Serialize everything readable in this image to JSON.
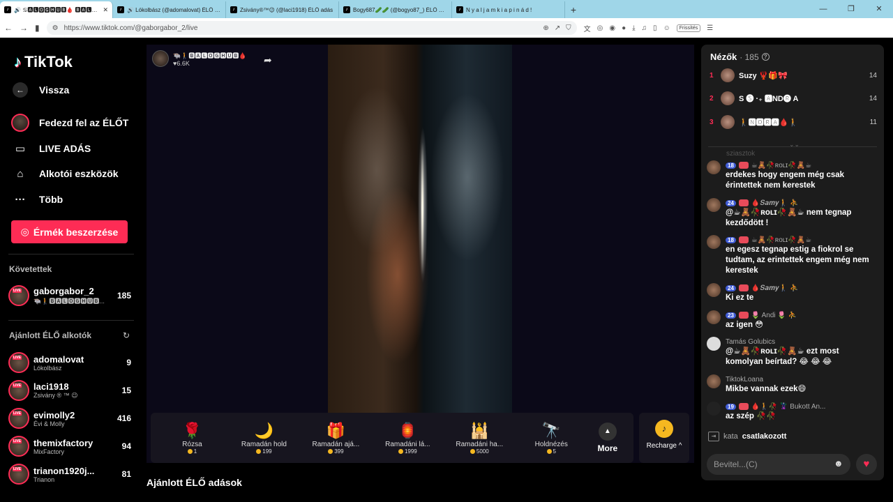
{
  "browser": {
    "tabs": [
      {
        "title": "🔊 ♋🅰🅻🅾🅶🅷🆄🅱🩸 🅱🅰🅻🅾🅶🅷🆄🅱",
        "active": true
      },
      {
        "title": "🔊 Lókolbász (@adomalovat) ÉLŐ adá",
        "active": false
      },
      {
        "title": "Zsivány®™😉 (@laci1918) ÉLŐ adás",
        "active": false
      },
      {
        "title": "Bogy687🥒🥒 (@bogyo87_) ÉLŐ adá",
        "active": false
      },
      {
        "title": "N y a l j a m k i a p i n á d !",
        "active": false
      }
    ],
    "new_tab": "+",
    "url": "https://www.tiktok.com/@gaborgabor_2/live",
    "refresh_label": "Frissítés"
  },
  "sidebar": {
    "logo": "TikTok",
    "back": "Vissza",
    "explore_live": "Fedezd fel az ÉLŐT",
    "live_studio": "LIVE ADÁS",
    "creator_tools": "Alkotói eszközök",
    "more": "Több",
    "coins_button": "Érmék beszerzése",
    "following_title": "Követettek",
    "following": [
      {
        "name": "gaborgabor_2",
        "sub": "🐃🚶🅱🅰🅻🅾🅶🅷🆄🅱...",
        "count": "185"
      }
    ],
    "suggested_title": "Ajánlott ÉLŐ alkotók",
    "suggested": [
      {
        "name": "adomalovat",
        "sub": "Lókolbász",
        "count": "9"
      },
      {
        "name": "laci1918",
        "sub": "Zsivány ® ™ 😉",
        "count": "15"
      },
      {
        "name": "evimolly2",
        "sub": "Évi & Molly",
        "count": "416"
      },
      {
        "name": "themixfactory",
        "sub": "MixFactory",
        "count": "94"
      },
      {
        "name": "trianon1920j...",
        "sub": "Trianon",
        "count": "81"
      }
    ]
  },
  "stage": {
    "host_name": "🐃🚶🅱🅰🅻🅾🅶🅷🆄🅱🩸",
    "host_likes": "♥6.6K",
    "gifts": [
      {
        "icon": "🌹",
        "name": "Rózsa",
        "price": "1"
      },
      {
        "icon": "🌙",
        "name": "Ramadán hold",
        "price": "199"
      },
      {
        "icon": "🎁",
        "name": "Ramadán ajá...",
        "price": "399"
      },
      {
        "icon": "🏮",
        "name": "Ramadáni lá...",
        "price": "1999"
      },
      {
        "icon": "🕌",
        "name": "Ramadáni ha...",
        "price": "5000"
      },
      {
        "icon": "🔭",
        "name": "Holdnézés",
        "price": "5"
      }
    ],
    "more_label": "More",
    "recharge_label": "Recharge ^"
  },
  "suggest_title": "Ajánlott ÉLŐ adások",
  "chat": {
    "viewers_label": "Nézők",
    "viewers_count": "· 185",
    "ranking": [
      {
        "rank": "1",
        "name": "Suzy 🦞🎁🎀",
        "score": "14"
      },
      {
        "rank": "2",
        "name": "S 🅢 ·₊ 🅰ND🅡 A",
        "score": "14"
      },
      {
        "rank": "3",
        "name": "🚶🅽🅾🆁🅰🩸🚶",
        "score": "11"
      }
    ],
    "cut_text": "sziasztok",
    "messages": [
      {
        "level": "18",
        "name": "☕🧸🥀ʀᴏʟɪ🥀🧸☕",
        "text": "erdekes hogy engem még csak érintettek nem kerestek"
      },
      {
        "level": "24",
        "name": "🩸𝑺𝒂𝒎𝒚🚶 ⛹",
        "text": "@☕🧸🥀ʀᴏʟɪ🥀🧸☕ nem tegnap kezdődött !"
      },
      {
        "level": "18",
        "name": "☕🧸🥀ʀᴏʟɪ🥀🧸☕",
        "text": "en egesz tegnap estig a fiokrol se tudtam, az erintettek engem még nem kerestek"
      },
      {
        "level": "24",
        "name": "🩸𝑺𝒂𝒎𝒚🚶 ⛹",
        "text": "Ki ez te"
      },
      {
        "level": "23",
        "name": "🌷 Andi 🌷 ⛹",
        "text": "az igen 😳"
      },
      {
        "level": "",
        "name": "Tamás Golubics",
        "text": "@☕🧸🥀ʀᴏʟɪ🥀🧸☕ ezt most komolyan beírtad? 😂 😂 😂"
      },
      {
        "level": "",
        "name": "TiktokLoana",
        "text": "Mikbe vannak ezek😄"
      },
      {
        "level": "19",
        "name": "🩸🚶🥀 🦹 Bukott An...",
        "text": "az szép 🥀🥀"
      }
    ],
    "joined_name": "kata",
    "joined_text": "csatlakozott",
    "input_placeholder": "Bevitel...(C)"
  },
  "colors": {
    "accent": "#fe2c55",
    "level_badge": "#3f5bd6",
    "coin": "#f5b820"
  }
}
